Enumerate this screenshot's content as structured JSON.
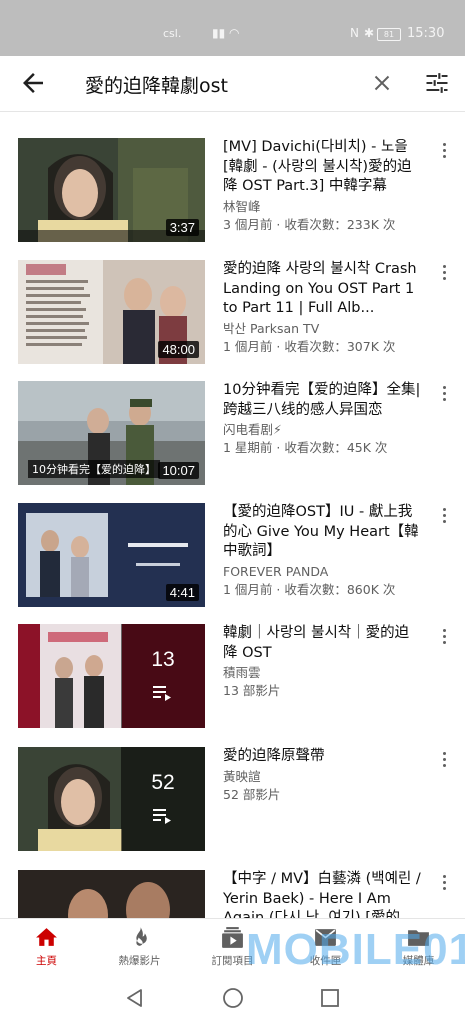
{
  "status_bar": {
    "carrier": "csl.",
    "time": "15:30",
    "battery": "81"
  },
  "search": {
    "query": "愛的迫降韓劇ost"
  },
  "results": [
    {
      "type": "video",
      "title": "[MV] Davichi(다비치) - 노을 [韓劇 - (사랑의 불시착)愛的迫降 OST Part.3] 中韓字幕",
      "channel": "林智峰",
      "meta": "3 個月前 · 收看次數：233K 次",
      "duration": "3:37"
    },
    {
      "type": "video",
      "title": "愛的迫降 사랑의 불시착 Crash Landing on You OST Part 1 to Part 11 | Full Alb...",
      "channel": "박산 Parksan TV",
      "meta": "1 個月前 · 收看次數：307K 次",
      "duration": "48:00"
    },
    {
      "type": "video",
      "title": "10分钟看完【爱的迫降】全集|跨越三八线的感人异国恋",
      "channel": "闪电看剧⚡",
      "meta": "1 星期前 · 收看次數：45K 次",
      "duration": "10:07",
      "thumb_caption": "10分钟看完【爱的迫降】"
    },
    {
      "type": "video",
      "title": "【愛的迫降OST】IU - 獻上我的心 Give You My Heart【韓中歌詞】",
      "channel": "FOREVER PANDA",
      "meta": "1 個月前 · 收看次數：860K 次",
      "duration": "4:41"
    },
    {
      "type": "playlist",
      "title": "韓劇｜사랑의 불시착｜愛的迫降 OST",
      "channel": "積雨雲",
      "meta": "13 部影片",
      "count": "13"
    },
    {
      "type": "playlist",
      "title": "愛的迫降原聲帶",
      "channel": "黃映諠",
      "meta": "52 部影片",
      "count": "52"
    },
    {
      "type": "video",
      "title": "【中字 / MV】白藝潾 (백예린 / Yerin Baek) - Here I Am Again (다시 난, 여기) [愛的...",
      "channel": "",
      "meta": "",
      "duration": ""
    }
  ],
  "bottom_nav": [
    {
      "label": "主頁",
      "icon": "home-icon",
      "active": true
    },
    {
      "label": "熱爆影片",
      "icon": "flame-icon",
      "active": false
    },
    {
      "label": "訂閱項目",
      "icon": "subscriptions-icon",
      "active": false
    },
    {
      "label": "收件匣",
      "icon": "inbox-icon",
      "active": false
    },
    {
      "label": "媒體庫",
      "icon": "library-icon",
      "active": false
    }
  ],
  "watermark": "MOBILE01",
  "colors": {
    "accent": "#cc0000",
    "text": "#0f0f0f",
    "secondary_text": "#606060",
    "status_bar": "#bdbdbd"
  }
}
